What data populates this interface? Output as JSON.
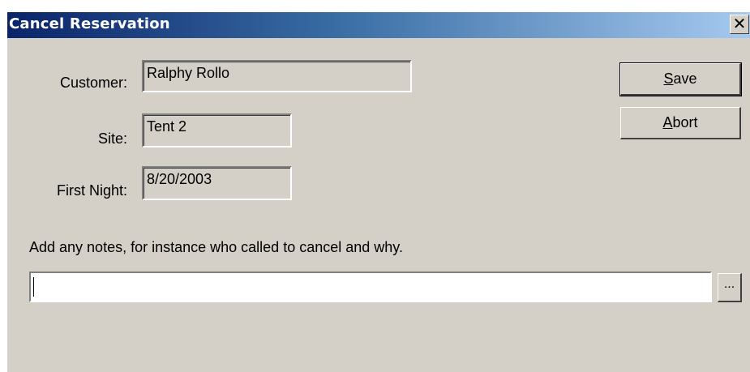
{
  "window": {
    "title": "Cancel Reservation",
    "close_label": "✕"
  },
  "form": {
    "customer_label": "Customer:",
    "customer_value": "Ralphy Rollo",
    "site_label": "Site:",
    "site_value": "Tent 2",
    "first_night_label": "First Night:",
    "first_night_value": "8/20/2003"
  },
  "buttons": {
    "save_accel": "S",
    "save_rest": "ave",
    "abort_accel": "A",
    "abort_rest": "bort",
    "browse_label": "..."
  },
  "notes": {
    "label": "Add any notes, for instance who called to cancel and why.",
    "value": ""
  },
  "colors": {
    "titlebar_start": "#0a246a",
    "titlebar_end": "#a6caf0",
    "face": "#d4d0c8"
  }
}
